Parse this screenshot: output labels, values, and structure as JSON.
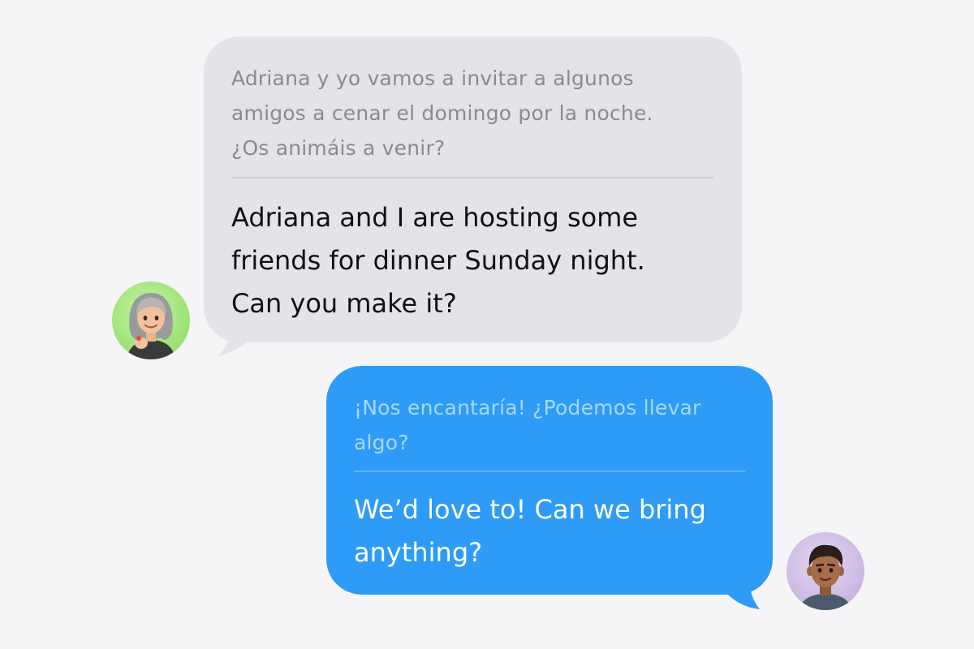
{
  "conversation": {
    "incoming": {
      "original_text": "Adriana y yo vamos a invitar a algunos\namigos a cenar el domingo por la noche.\n¿Os animáis a venir?",
      "translated_text": "Adriana and I are hosting some\nfriends for dinner Sunday night.\nCan you make it?",
      "bubble_color": "#e4e4e8",
      "avatar_icon": "memoji-woman-gray-hair-icon",
      "avatar_background": "#a0e47a"
    },
    "outgoing": {
      "original_text": "¡Nos encantaría! ¿Podemos llevar\nalgo?",
      "translated_text": "We’d love to! Can we bring\nanything?",
      "bubble_color": "#2e9cf7",
      "avatar_icon": "memoji-man-dark-hair-icon",
      "avatar_background": "#cbb9e2"
    }
  }
}
